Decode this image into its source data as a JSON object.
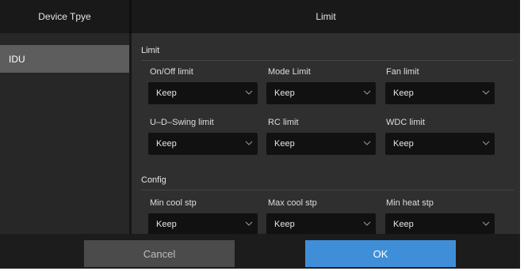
{
  "header": {
    "device_type_label": "Device Tpye",
    "limit_label": "Limit"
  },
  "sidebar": {
    "items": [
      {
        "label": "IDU",
        "selected": true
      }
    ]
  },
  "sections": [
    {
      "title": "Limit",
      "fields": [
        {
          "label": "On/Off limit",
          "value": "Keep"
        },
        {
          "label": "Mode Limit",
          "value": "Keep"
        },
        {
          "label": "Fan limit",
          "value": "Keep"
        },
        {
          "label": "U–D–Swing limit",
          "value": "Keep"
        },
        {
          "label": "RC limit",
          "value": "Keep"
        },
        {
          "label": "WDC limit",
          "value": "Keep"
        }
      ]
    },
    {
      "title": "Config",
      "fields": [
        {
          "label": "Min cool stp",
          "value": "Keep"
        },
        {
          "label": "Max cool stp",
          "value": "Keep"
        },
        {
          "label": "Min heat stp",
          "value": "Keep"
        }
      ]
    }
  ],
  "footer": {
    "cancel_label": "Cancel",
    "ok_label": "OK"
  },
  "colors": {
    "ok_button": "#3f8fd8",
    "selected_item": "#5d5d5d",
    "background": "#2c2c2c"
  },
  "icons": {
    "select_arrow": "chevron-down-icon"
  }
}
